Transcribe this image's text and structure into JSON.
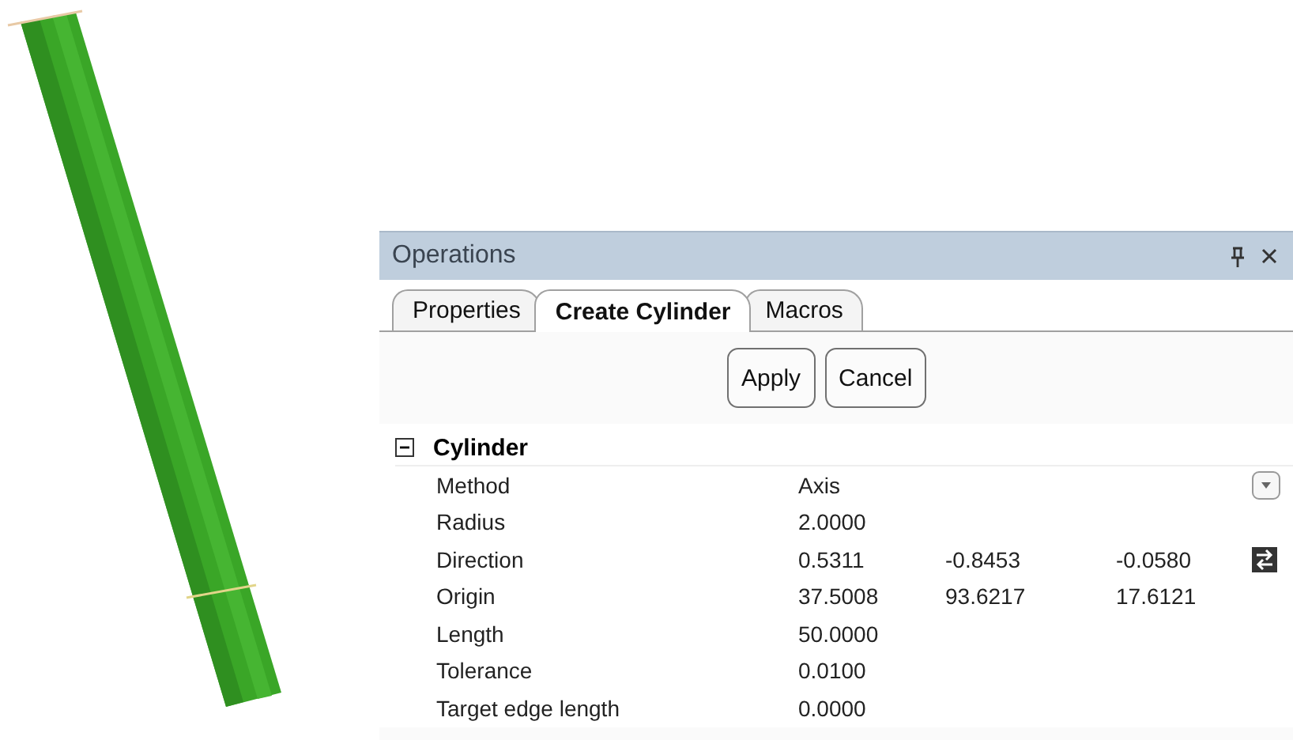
{
  "panel": {
    "title": "Operations"
  },
  "tabs": [
    {
      "label": "Properties",
      "selected": false
    },
    {
      "label": "Create Cylinder",
      "selected": true
    },
    {
      "label": "Macros",
      "selected": false
    }
  ],
  "buttons": [
    "Apply",
    "Cancel"
  ],
  "section": {
    "title": "Cylinder",
    "expanded": true,
    "rows": [
      {
        "label": "Method",
        "kind": "dropdown",
        "values": [
          "Axis"
        ]
      },
      {
        "label": "Radius",
        "kind": "plain",
        "values": [
          "2.0000"
        ]
      },
      {
        "label": "Direction",
        "kind": "swap",
        "values": [
          "0.5311",
          "-0.8453",
          "-0.0580"
        ]
      },
      {
        "label": "Origin",
        "kind": "plain",
        "values": [
          "37.5008",
          "93.6217",
          "17.6121"
        ]
      },
      {
        "label": "Length",
        "kind": "plain",
        "values": [
          "50.0000"
        ]
      },
      {
        "label": "Tolerance",
        "kind": "plain",
        "values": [
          "0.0100"
        ]
      },
      {
        "label": "Target edge length",
        "kind": "plain",
        "values": [
          "0.0000"
        ]
      }
    ]
  }
}
